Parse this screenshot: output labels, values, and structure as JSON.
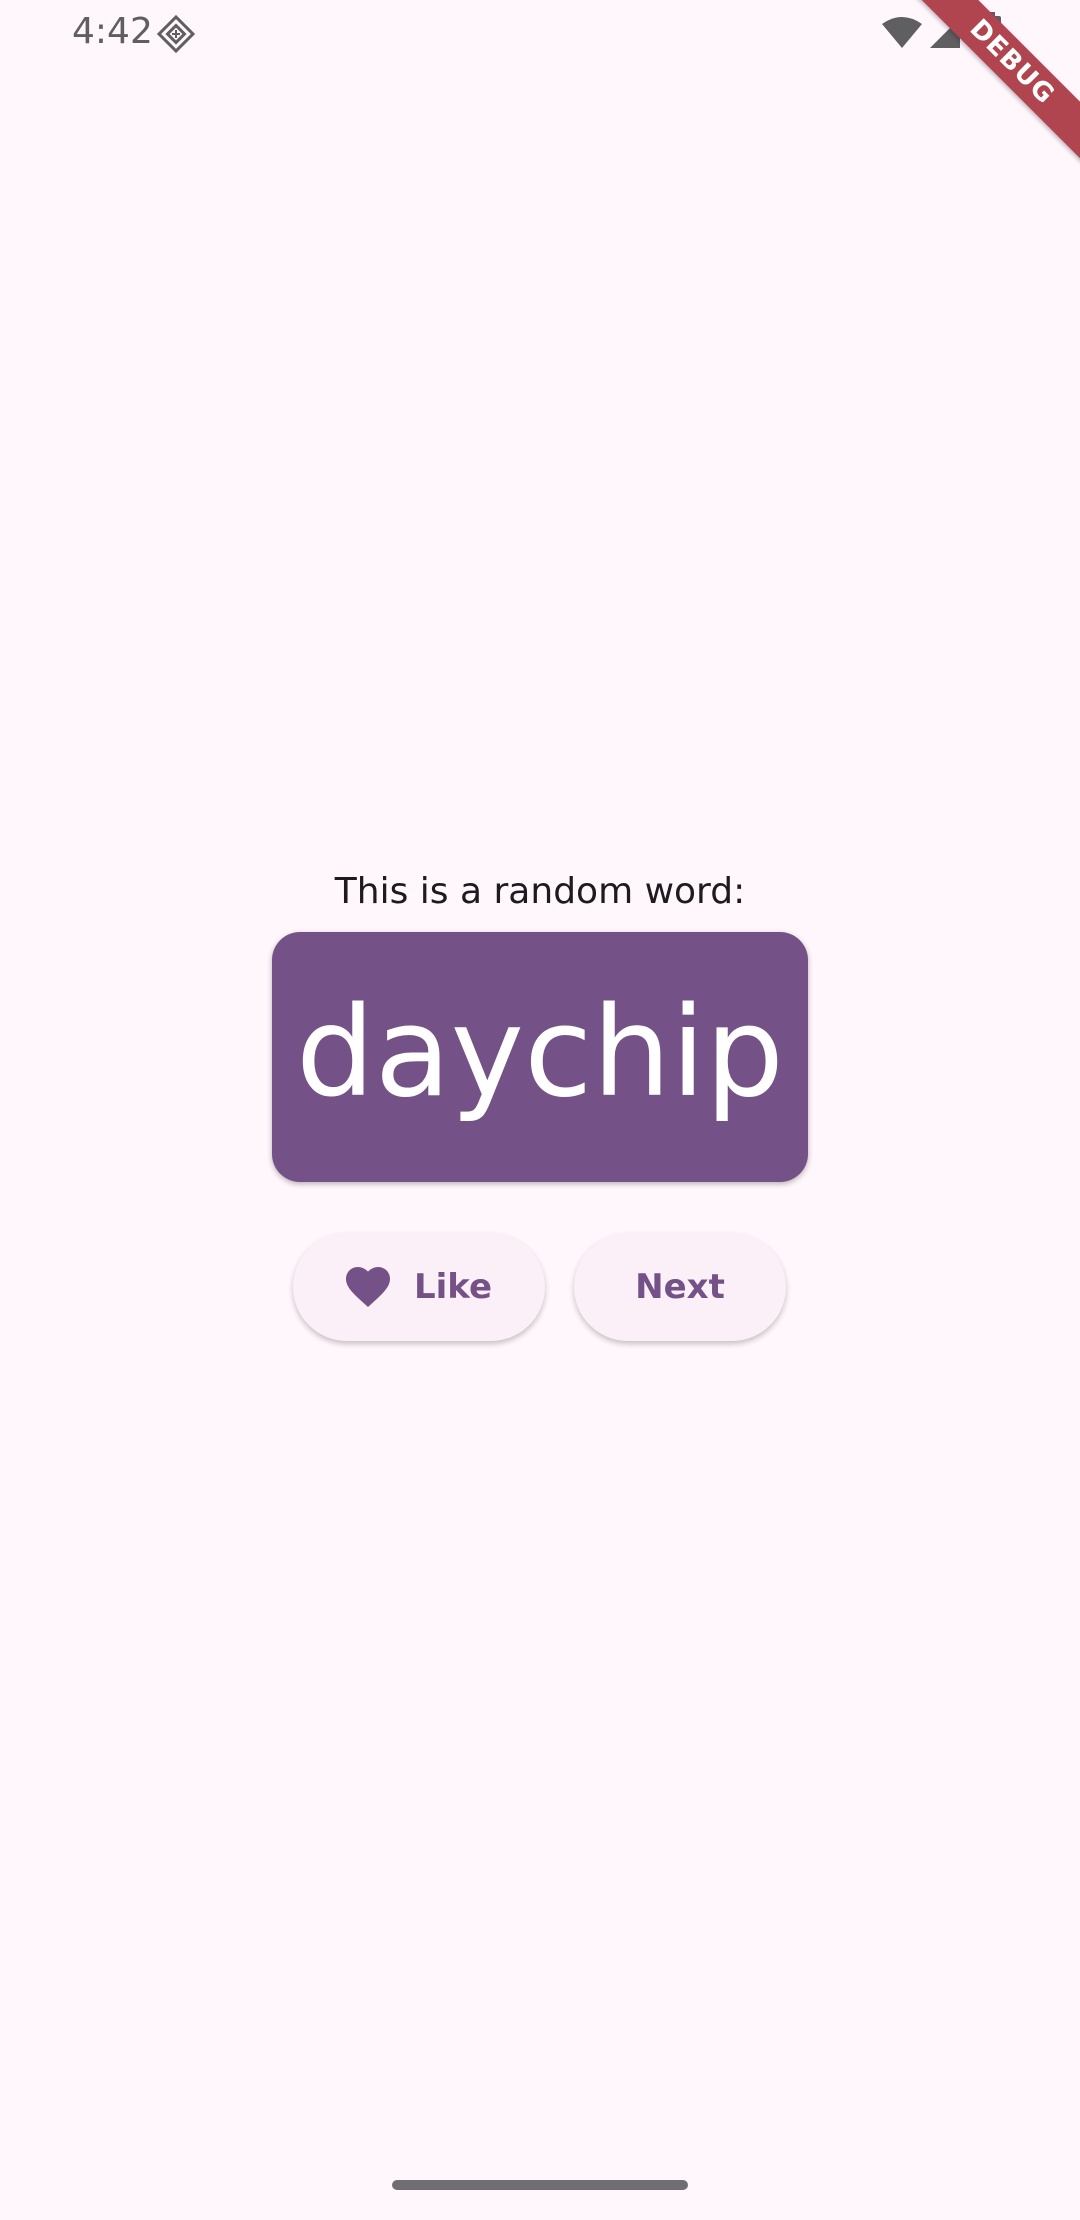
{
  "status_bar": {
    "time": "4:42",
    "notification_icon": "sim-diamond-icon",
    "icons": [
      "wifi-icon",
      "signal-icon",
      "battery-icon"
    ]
  },
  "debug_banner": {
    "label": "DEBUG",
    "color": "#b0454f"
  },
  "main": {
    "prompt": "This is a random word:",
    "word": "daychip",
    "like_button": {
      "label": "Like",
      "icon": "heart-icon"
    },
    "next_button": {
      "label": "Next"
    }
  },
  "colors": {
    "background": "#fff7fb",
    "primary": "#745187",
    "button_surface": "#fbf0f7",
    "on_primary": "#ffffff",
    "text": "#1d1b20"
  }
}
